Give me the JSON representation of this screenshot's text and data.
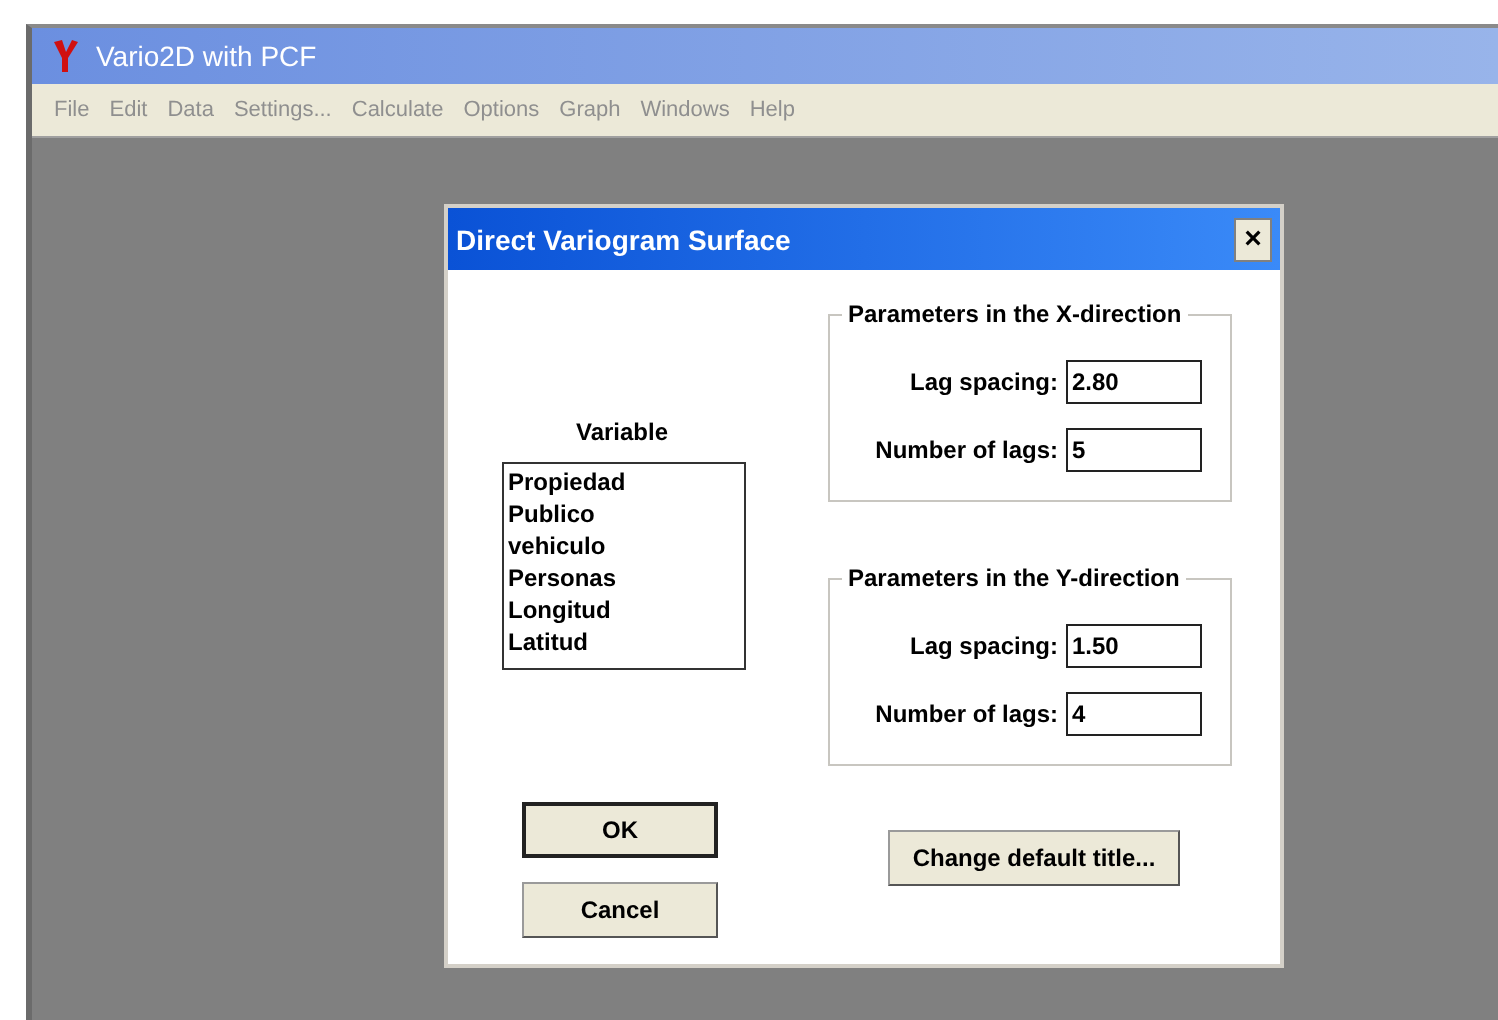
{
  "window": {
    "title": "Vario2D with PCF"
  },
  "menu": [
    {
      "label": "File",
      "disabled": true
    },
    {
      "label": "Edit",
      "disabled": true
    },
    {
      "label": "Data",
      "disabled": true
    },
    {
      "label": "Settings...",
      "disabled": true
    },
    {
      "label": "Calculate",
      "disabled": true
    },
    {
      "label": "Options",
      "disabled": true
    },
    {
      "label": "Graph",
      "disabled": true
    },
    {
      "label": "Windows",
      "disabled": true
    },
    {
      "label": "Help",
      "disabled": true
    }
  ],
  "dialog": {
    "title": "Direct Variogram Surface",
    "close": "×",
    "variable": {
      "label": "Variable",
      "items": [
        "Propiedad",
        "Publico",
        "vehiculo",
        "Personas",
        "Longitud",
        "Latitud"
      ]
    },
    "groups": [
      {
        "legend": "Parameters in the X-direction",
        "fields": [
          {
            "label": "Lag spacing:",
            "value": "2.80"
          },
          {
            "label": "Number of lags:",
            "value": "5"
          }
        ]
      },
      {
        "legend": "Parameters in the Y-direction",
        "fields": [
          {
            "label": "Lag spacing:",
            "value": "1.50"
          },
          {
            "label": "Number of lags:",
            "value": "4"
          }
        ]
      }
    ],
    "buttons": [
      {
        "label": "OK",
        "default": true
      },
      {
        "label": "Cancel",
        "default": false
      }
    ],
    "title_button": "Change default title..."
  }
}
